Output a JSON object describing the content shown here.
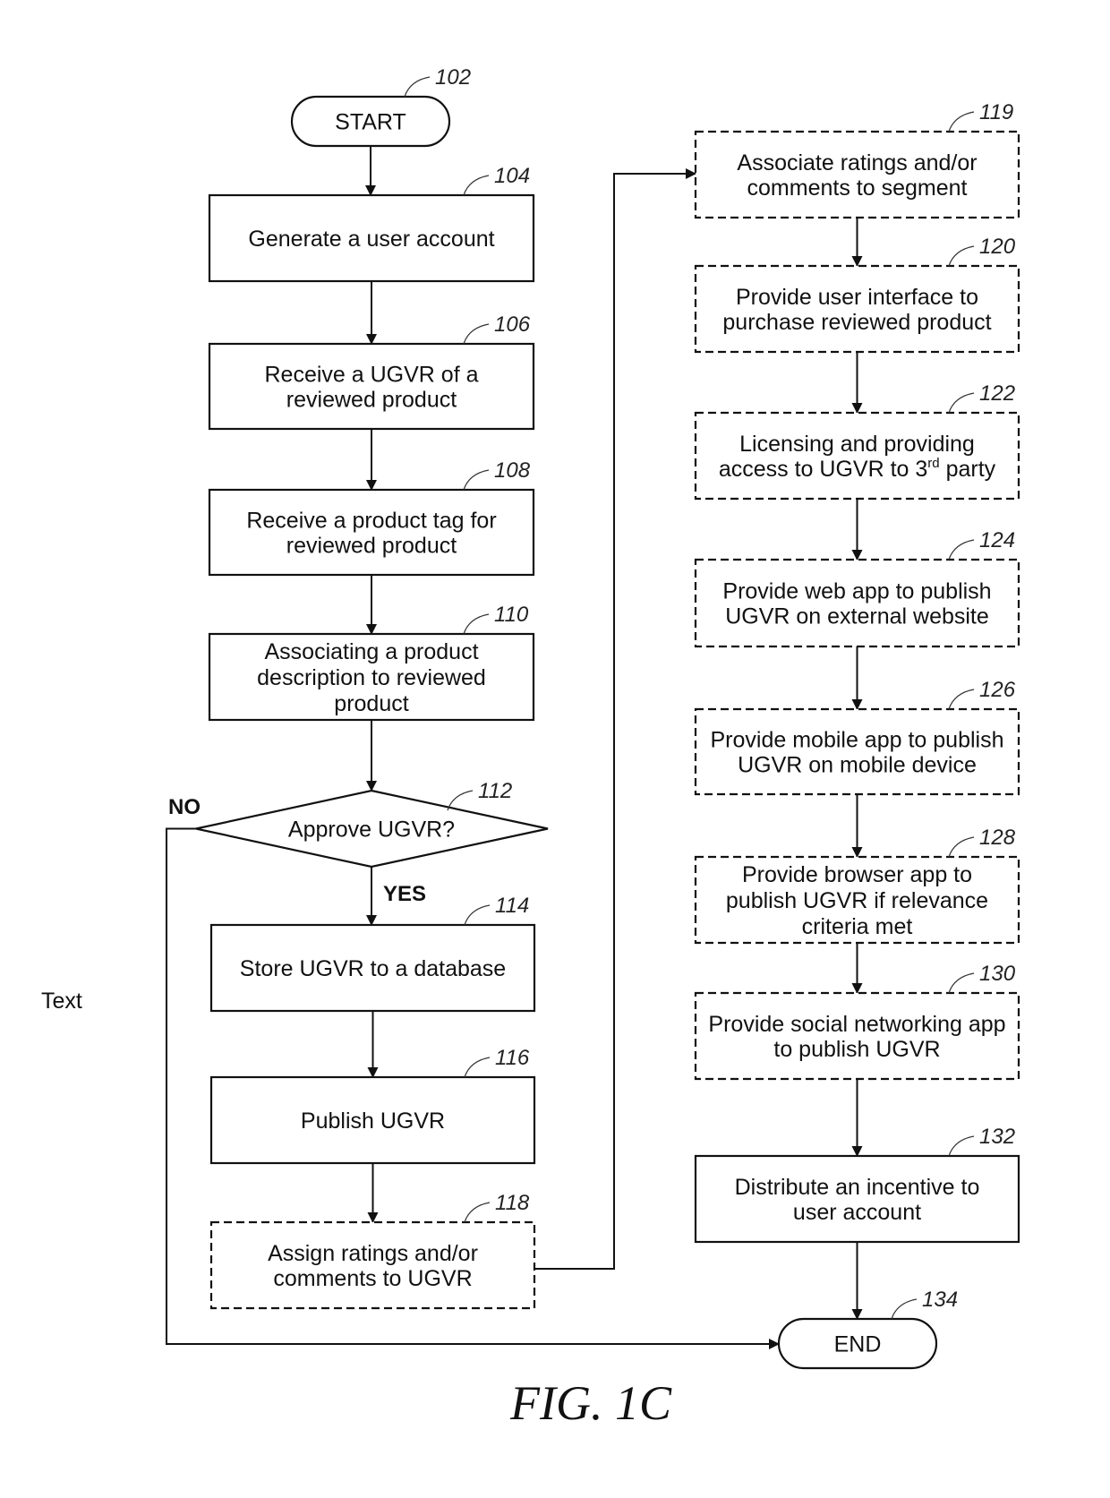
{
  "figure": {
    "caption": "FIG. 1C",
    "side_label": "Text"
  },
  "nodes": [
    {
      "id": "102",
      "type": "terminal",
      "ref": "102",
      "lines": [
        "START"
      ],
      "dashed": false
    },
    {
      "id": "104",
      "type": "process",
      "ref": "104",
      "lines": [
        "Generate a user account"
      ],
      "dashed": false
    },
    {
      "id": "106",
      "type": "process",
      "ref": "106",
      "lines": [
        "Receive a UGVR of a",
        "reviewed product"
      ],
      "dashed": false
    },
    {
      "id": "108",
      "type": "process",
      "ref": "108",
      "lines": [
        "Receive a product tag for",
        "reviewed product"
      ],
      "dashed": false
    },
    {
      "id": "110",
      "type": "process",
      "ref": "110",
      "lines": [
        "Associating a product",
        "description to reviewed",
        "product"
      ],
      "dashed": false
    },
    {
      "id": "112",
      "type": "decision",
      "ref": "112",
      "lines": [
        "Approve UGVR?"
      ],
      "dashed": false
    },
    {
      "id": "114",
      "type": "process",
      "ref": "114",
      "lines": [
        "Store UGVR to a database"
      ],
      "dashed": false
    },
    {
      "id": "116",
      "type": "process",
      "ref": "116",
      "lines": [
        "Publish UGVR"
      ],
      "dashed": false
    },
    {
      "id": "118",
      "type": "process",
      "ref": "118",
      "lines": [
        "Assign ratings and/or",
        "comments to UGVR"
      ],
      "dashed": true
    },
    {
      "id": "119",
      "type": "process",
      "ref": "119",
      "lines": [
        "Associate ratings and/or",
        "comments to segment"
      ],
      "dashed": true
    },
    {
      "id": "120",
      "type": "process",
      "ref": "120",
      "lines": [
        "Provide user interface to",
        "purchase reviewed product"
      ],
      "dashed": true
    },
    {
      "id": "122",
      "type": "process",
      "ref": "122",
      "lines": [
        "Licensing and providing",
        "access to UGVR to 3rd party"
      ],
      "dashed": true
    },
    {
      "id": "124",
      "type": "process",
      "ref": "124",
      "lines": [
        "Provide web app to publish",
        "UGVR on external website"
      ],
      "dashed": true
    },
    {
      "id": "126",
      "type": "process",
      "ref": "126",
      "lines": [
        "Provide mobile app to publish",
        "UGVR on mobile device"
      ],
      "dashed": true
    },
    {
      "id": "128",
      "type": "process",
      "ref": "128",
      "lines": [
        "Provide browser app to",
        "publish UGVR if relevance",
        "criteria met"
      ],
      "dashed": true
    },
    {
      "id": "130",
      "type": "process",
      "ref": "130",
      "lines": [
        "Provide social networking app",
        "to publish UGVR"
      ],
      "dashed": true
    },
    {
      "id": "132",
      "type": "process",
      "ref": "132",
      "lines": [
        "Distribute an incentive to",
        "user account"
      ],
      "dashed": false
    },
    {
      "id": "134",
      "type": "terminal",
      "ref": "134",
      "lines": [
        "END"
      ],
      "dashed": false
    }
  ],
  "edges": [
    {
      "from": "102",
      "to": "104",
      "label": ""
    },
    {
      "from": "104",
      "to": "106",
      "label": ""
    },
    {
      "from": "106",
      "to": "108",
      "label": ""
    },
    {
      "from": "108",
      "to": "110",
      "label": ""
    },
    {
      "from": "110",
      "to": "112",
      "label": ""
    },
    {
      "from": "112",
      "to": "114",
      "label": "YES"
    },
    {
      "from": "112",
      "to": "134",
      "label": "NO"
    },
    {
      "from": "114",
      "to": "116",
      "label": ""
    },
    {
      "from": "116",
      "to": "118",
      "label": ""
    },
    {
      "from": "118",
      "to": "119",
      "label": ""
    },
    {
      "from": "119",
      "to": "120",
      "label": ""
    },
    {
      "from": "120",
      "to": "122",
      "label": ""
    },
    {
      "from": "122",
      "to": "124",
      "label": ""
    },
    {
      "from": "124",
      "to": "126",
      "label": ""
    },
    {
      "from": "126",
      "to": "128",
      "label": ""
    },
    {
      "from": "128",
      "to": "130",
      "label": ""
    },
    {
      "from": "130",
      "to": "132",
      "label": ""
    },
    {
      "from": "132",
      "to": "134",
      "label": ""
    }
  ],
  "labels": {
    "yes": "YES",
    "no": "NO"
  }
}
